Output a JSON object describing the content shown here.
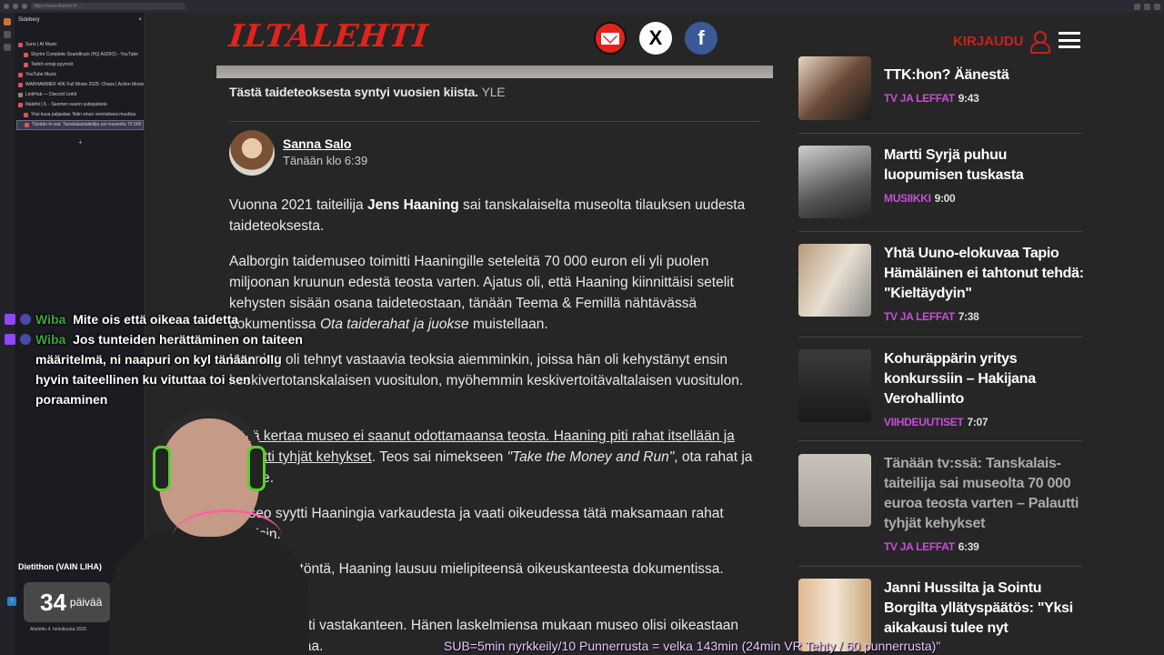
{
  "browser": {
    "url": "https://www.iltalehti.fi/..."
  },
  "sidebery": {
    "title": "Sidebery",
    "items": [
      {
        "label": "Suno | AI Music"
      },
      {
        "label": "Skyrim Complete Soundtrack (HQ AUDIO) - YouTube"
      },
      {
        "label": "Twitch emoji pyynnöt"
      },
      {
        "label": "YouTube Music"
      },
      {
        "label": "WARHAMMER 40K Full Movie 2025: Chaos | Action Movies"
      },
      {
        "label": "LinkHub — Discord Linkit"
      },
      {
        "label": "Iltalehti | IL - Suomen suurin uutispalvelu"
      },
      {
        "label": "Yksi kuva paljastaa: Näin sinun verotuksesi muuttuu"
      },
      {
        "label": "Tänään tv:ssä: Tanskalaistaiteilija sai museolta 70 000 euroa"
      }
    ]
  },
  "site": {
    "logo": "ILTALEHTI",
    "login_label": "KIRJAUDU",
    "share": {
      "x": "X",
      "facebook": "f"
    }
  },
  "article": {
    "caption": "Tästä taideteoksesta syntyi vuosien kiista.",
    "caption_source": "YLE",
    "author": "Sanna Salo",
    "published": "Tänään klo 6:39",
    "p1_a": "Vuonna 2021 taiteilija ",
    "p1_b": "Jens Haaning",
    "p1_c": " sai tanskalaiselta museolta tilauksen uudesta taideteoksesta.",
    "p2_a": "Aalborgin taidemuseo toimitti Haaningille seteleitä 70 000 euron eli yli puolen miljoonan kruunun edestä teosta varten. Ajatus oli, että Haaning kiinnittäisi setelit kehysten sisään osana taideteostaan, tänään Teema & Femillä nähtävässä dokumentissa ",
    "p2_b": "Ota taiderahat ja juokse",
    "p2_c": " muistellaan.",
    "p3": "Haaning oli tehnyt vastaavia teoksia aiemminkin, joissa hän oli kehystänyt ensin keskivertotanskalaisen vuositulon, myöhemmin keskivertoitävaltalaisen vuositulon.",
    "p4_a": "Tällä kertaa museo ei saanut odottamaansa teosta. Haaning piti rahat itsellään ja palautti tyhjät kehykset",
    "p4_b": ". Teos sai nimekseen ",
    "p4_c": "\"Take the Money and Run\"",
    "p4_d": ", ota rahat ja juokse.",
    "p5": "Museo syytti Haaningia varkaudesta ja vaati oikeudessa tätä maksamaan rahat takaisin.",
    "p6": "– Se on älytöntä, Haaning lausuu mielipiteensä oikeuskanteesta dokumentissa.",
    "p7": "Haaning nosti vastakanteen. Hänen laskelmiensa mukaan museo olisi oikeastaan hänelle velkaa."
  },
  "sidebar_news": [
    {
      "title": "TTK:hon? Äänestä",
      "category": "TV JA LEFFAT",
      "time": "9:43"
    },
    {
      "title": "Martti Syrjä puhuu luopumisen tuskasta",
      "category": "MUSIIKKI",
      "time": "9:00"
    },
    {
      "title": "Yhtä Uuno-elokuvaa Tapio Hämäläinen ei tahtonut tehdä: \"Kieltäydyin\"",
      "category": "TV JA LEFFAT",
      "time": "7:38"
    },
    {
      "title": "Kohuräppärin yritys konkurssiin – Hakijana Verohallinto",
      "category": "VIIHDEUUTISET",
      "time": "7:07"
    },
    {
      "title": "Tänään tv:ssä: Tanskalais-taiteilija sai museolta 70 000 euroa teosta varten – Palautti tyhjät kehykset",
      "category": "TV JA LEFFAT",
      "time": "6:39"
    },
    {
      "title": "Janni Hussilta ja Sointu Borgilta yllätyspäätös: \"Yksi aikakausi tulee nyt",
      "category": "",
      "time": ""
    }
  ],
  "overlay": {
    "chat": [
      {
        "user": "Wiba",
        "message": "Mite ois että oikeaa taidetta"
      },
      {
        "user": "Wiba",
        "message": "Jos tunteiden herättäminen on taiteen määritelmä, ni naapuri on kyl tänään ollu hyvin taiteellinen ku vituttaa toi sen poraaminen"
      }
    ],
    "subs_title": "Dietithon (VAIN LIHA)",
    "subs_days": "34",
    "subs_unit": "päivää",
    "subs_since": "Aloitettu 4. heinäkuuta 2026",
    "ticker": "SUB=5min nyrkkeily/10 Punnerrusta = velka 143min (24min VR Tehty / 60 punnerrusta)\""
  },
  "colors": {
    "brand_red": "#e0231d",
    "category_purple": "#c54fd6",
    "chat_user_green": "#3ba53b"
  }
}
